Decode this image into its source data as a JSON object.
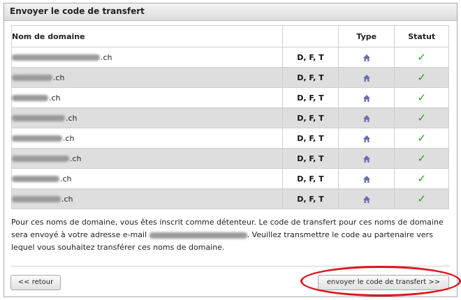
{
  "panel": {
    "title": "Envoyer le code de transfert"
  },
  "table": {
    "headers": {
      "name": "Nom de domaine",
      "flags": "",
      "type": "Type",
      "status": "Statut"
    },
    "rows": [
      {
        "suffix": ".ch",
        "flags": "D, F, T",
        "type_icon": "house-icon",
        "status": "✓"
      },
      {
        "suffix": ".ch",
        "flags": "D, F, T",
        "type_icon": "house-icon",
        "status": "✓"
      },
      {
        "suffix": ".ch",
        "flags": "D, F, T",
        "type_icon": "house-icon",
        "status": "✓"
      },
      {
        "suffix": ".ch",
        "flags": "D, F, T",
        "type_icon": "house-icon",
        "status": "✓"
      },
      {
        "suffix": ".ch",
        "flags": "D, F, T",
        "type_icon": "house-icon",
        "status": "✓"
      },
      {
        "suffix": ".ch",
        "flags": "D, F, T",
        "type_icon": "house-icon",
        "status": "✓"
      },
      {
        "suffix": ".ch",
        "flags": "D, F, T",
        "type_icon": "house-icon",
        "status": "✓"
      },
      {
        "suffix": ".ch",
        "flags": "D, F, T",
        "type_icon": "house-icon",
        "status": "✓"
      }
    ]
  },
  "info": {
    "text_before": "Pour ces noms de domaine, vous êtes inscrit comme détenteur. Le code de transfert pour ces noms de domaine sera envoyé à votre adresse e-mail ",
    "text_after": ". Veuillez transmettre le code au partenaire vers lequel vous souhaitez transférer ces noms de domaine."
  },
  "buttons": {
    "back": "<< retour",
    "send": "envoyer le code de transfert >>"
  },
  "colors": {
    "annotation": "#e0141c",
    "check": "#2e9a1e",
    "house": "#6b6bb0"
  }
}
